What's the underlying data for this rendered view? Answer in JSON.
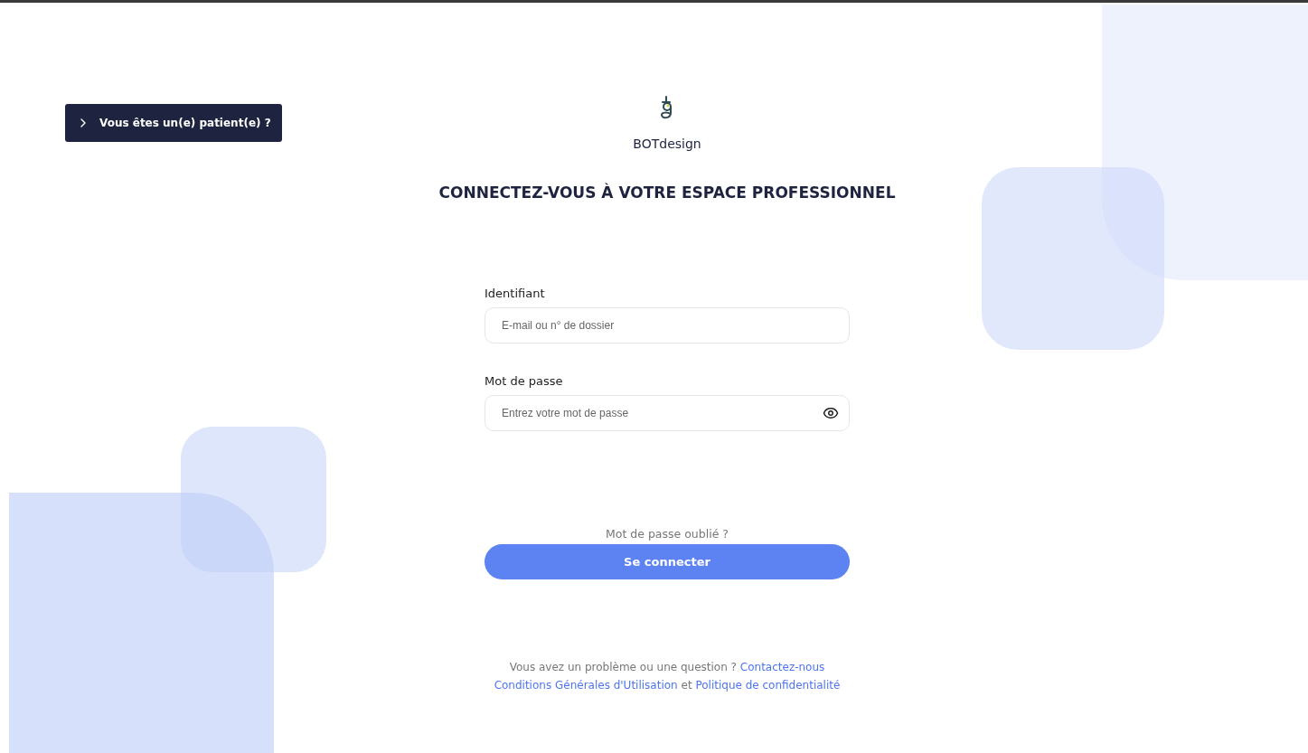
{
  "patient_button": {
    "label": "Vous êtes un(e) patient(e) ?"
  },
  "brand": {
    "name": "BOTdesign"
  },
  "heading": "CONNECTEZ-VOUS À VOTRE ESPACE PROFESSIONNEL",
  "fields": [
    {
      "kind": "text",
      "label": "Identifiant",
      "placeholder": "E-mail ou n° de dossier"
    },
    {
      "kind": "password",
      "label": "Mot de passe",
      "placeholder": "Entrez votre mot de passe"
    }
  ],
  "forgot_link": "Mot de passe oublié ?",
  "submit_button": "Se connecter",
  "footer_lines": [
    {
      "parts": [
        {
          "kind": "text",
          "text": "Vous avez un problème ou une question ? "
        },
        {
          "kind": "link",
          "text": "Contactez-nous"
        }
      ]
    },
    {
      "parts": [
        {
          "kind": "link",
          "text": "Conditions Générales d'Utilisation"
        },
        {
          "kind": "text",
          "text": " et "
        },
        {
          "kind": "link",
          "text": "Politique de confidentialité"
        }
      ]
    }
  ]
}
